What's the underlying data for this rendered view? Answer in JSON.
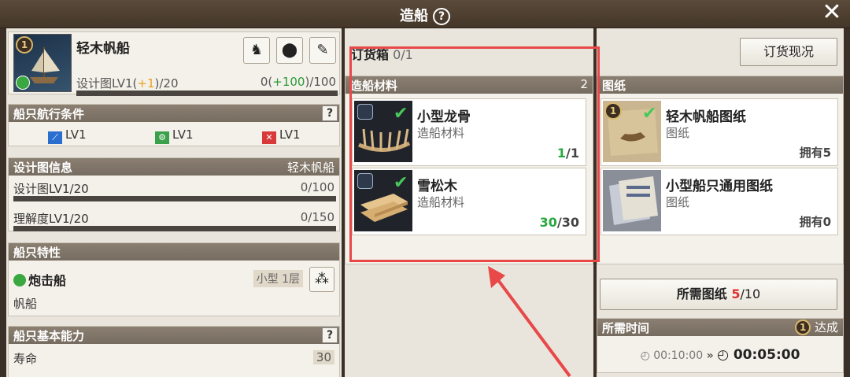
{
  "window": {
    "title": "造船",
    "help": "?"
  },
  "ship": {
    "tier_badge": "1",
    "name": "轻木帆船",
    "design_prefix": "设计图LV1(",
    "design_plus": "+1",
    "design_suffix": ")/20",
    "exp_prefix": "0(",
    "exp_plus": "+100",
    "exp_suffix": ")/100",
    "buttons": [
      "captain-icon",
      "location-pin-icon",
      "edit-icon"
    ]
  },
  "conditions": {
    "title": "船只航行条件",
    "help": "?",
    "items": [
      {
        "label": "LV1",
        "color": "#2a6fd0"
      },
      {
        "label": "LV1",
        "color": "#3aa04a"
      },
      {
        "label": "LV1",
        "color": "#d83a3a"
      }
    ]
  },
  "blueprint_info": {
    "title": "设计图信息",
    "value": "轻木帆船",
    "rows": [
      {
        "label": "设计图LV1/20",
        "value": "0/100",
        "progress": 0
      },
      {
        "label": "理解度LV1/20",
        "value": "0/150",
        "progress": 0
      }
    ]
  },
  "traits": {
    "title": "船只特性",
    "type": "炮击船",
    "size": "小型 1层",
    "sub": "帆船"
  },
  "abilities": {
    "title": "船只基本能力",
    "help": "?",
    "rows": [
      {
        "label": "寿命",
        "value": "30"
      }
    ]
  },
  "order": {
    "label": "订货箱",
    "count": "0/1",
    "button": "订货现况"
  },
  "materials": {
    "title": "造船材料",
    "count": "2",
    "items": [
      {
        "name": "小型龙骨",
        "type": "造船材料",
        "have": "1",
        "need": "/1"
      },
      {
        "name": "雪松木",
        "type": "造船材料",
        "have": "30",
        "need": "/30"
      }
    ]
  },
  "blueprints": {
    "title": "图纸",
    "items": [
      {
        "badge": "1",
        "name": "轻木帆船图纸",
        "type": "图纸",
        "own": "拥有5"
      },
      {
        "name": "小型船只通用图纸",
        "type": "图纸",
        "own": "拥有0"
      }
    ],
    "required_label": "所需图纸",
    "required_have": "5",
    "required_need": "/10"
  },
  "time": {
    "title": "所需时间",
    "badge": "1",
    "done_label": "达成",
    "original": "00:10:00",
    "reduced": "00:05:00"
  },
  "colors": {
    "accent_red": "#e84848",
    "ok_green": "#2aa840"
  }
}
